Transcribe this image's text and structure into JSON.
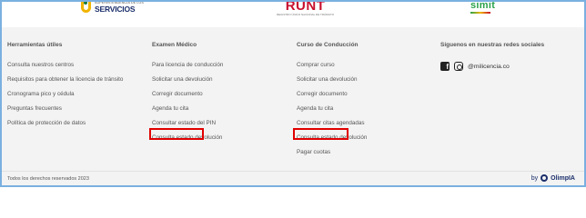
{
  "logos": {
    "servicios": {
      "small": "SUPERINTENDENCIA DE LOS",
      "big": "SERVICIOS"
    },
    "runt": {
      "big": "RUNT",
      "small": "REGISTRO ÚNICO NACIONAL DE TRÁNSITO"
    },
    "simit": {
      "text": "simit"
    }
  },
  "footer": {
    "col1": {
      "title": "Herramientas útiles",
      "items": [
        "Consulta nuestros centros",
        "Requisitos para obtener la licencia de tránsito",
        "Cronograma pico y cédula",
        "Preguntas frecuentes",
        "Política de protección de datos"
      ]
    },
    "col2": {
      "title": "Examen Médico",
      "items": [
        "Para licencia de conducción",
        "Solicitar una devolución",
        "Corregir documento",
        "Agenda tu cita",
        "Consultar estado del PIN",
        "Consulta estado devolución"
      ]
    },
    "col3": {
      "title": "Curso de Conducción",
      "items": [
        "Comprar curso",
        "Solicitar una devolución",
        "Corregir documento",
        "Agenda tu cita",
        "Consultar citas agendadas",
        "Consulta estado devolución",
        "Pagar cuotas"
      ]
    },
    "col4": {
      "title": "Síguenos en nuestras redes sociales",
      "handle": "@milicencia.co"
    }
  },
  "bottom": {
    "copyright": "Todos los derechos reservados 2023",
    "by": "by",
    "brand": "OlimpIA"
  },
  "colors": {
    "highlight": "#e00000",
    "footer_bg": "#f3f3f3",
    "runt_red": "#c8102e",
    "simit_green": "#2aa24a",
    "brand_navy": "#1b2e6b"
  },
  "icons": [
    "facebook-icon",
    "instagram-icon"
  ]
}
